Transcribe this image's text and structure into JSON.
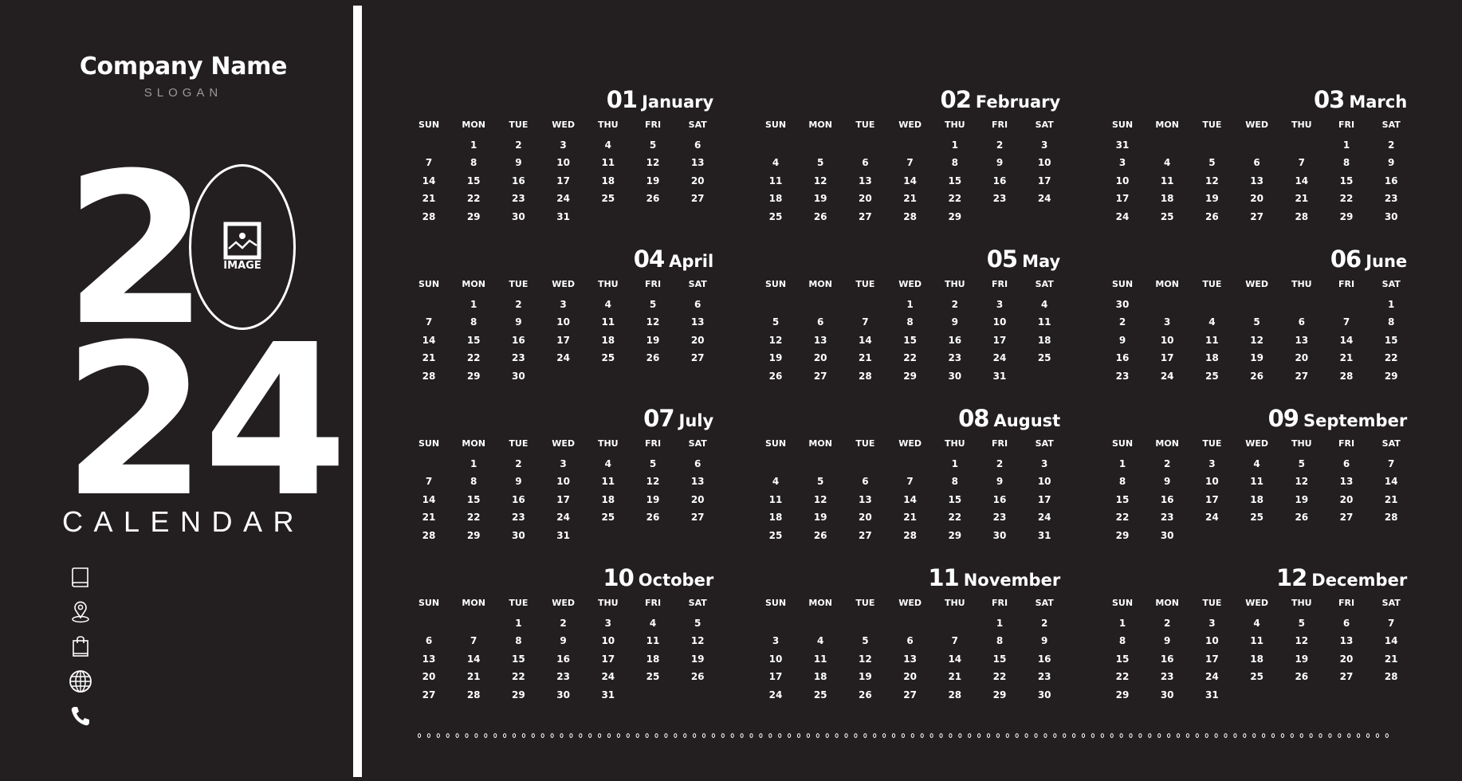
{
  "header": {
    "company_name": "Company Name",
    "slogan": "SLOGAN"
  },
  "hero": {
    "year_first": "2",
    "year_last": "24",
    "image_placeholder_label": "IMAGE",
    "subtitle": "CALENDAR"
  },
  "contact_icons": [
    "book-icon",
    "location-pin-icon",
    "shopping-bag-icon",
    "globe-icon",
    "phone-icon"
  ],
  "colors": {
    "background": "#231f20",
    "foreground": "#ffffff",
    "slogan": "#9a9899"
  },
  "weekdays": [
    "SUN",
    "MON",
    "TUE",
    "WED",
    "THU",
    "FRI",
    "SAT"
  ],
  "months": [
    {
      "num": "01",
      "name": "January",
      "weeks": [
        [
          "",
          "1",
          "2",
          "3",
          "4",
          "5",
          "6"
        ],
        [
          "7",
          "8",
          "9",
          "10",
          "11",
          "12",
          "13"
        ],
        [
          "14",
          "15",
          "16",
          "17",
          "18",
          "19",
          "20"
        ],
        [
          "21",
          "22",
          "23",
          "24",
          "25",
          "26",
          "27"
        ],
        [
          "28",
          "29",
          "30",
          "31",
          "",
          "",
          ""
        ]
      ]
    },
    {
      "num": "02",
      "name": "February",
      "weeks": [
        [
          "",
          "",
          "",
          "",
          "1",
          "2",
          "3"
        ],
        [
          "4",
          "5",
          "6",
          "7",
          "8",
          "9",
          "10"
        ],
        [
          "11",
          "12",
          "13",
          "14",
          "15",
          "16",
          "17"
        ],
        [
          "18",
          "19",
          "20",
          "21",
          "22",
          "23",
          "24"
        ],
        [
          "25",
          "26",
          "27",
          "28",
          "29",
          "",
          ""
        ]
      ]
    },
    {
      "num": "03",
      "name": "March",
      "weeks": [
        [
          "31",
          "",
          "",
          "",
          "",
          "1",
          "2"
        ],
        [
          "3",
          "4",
          "5",
          "6",
          "7",
          "8",
          "9"
        ],
        [
          "10",
          "11",
          "12",
          "13",
          "14",
          "15",
          "16"
        ],
        [
          "17",
          "18",
          "19",
          "20",
          "21",
          "22",
          "23"
        ],
        [
          "24",
          "25",
          "26",
          "27",
          "28",
          "29",
          "30"
        ]
      ]
    },
    {
      "num": "04",
      "name": "April",
      "weeks": [
        [
          "",
          "1",
          "2",
          "3",
          "4",
          "5",
          "6"
        ],
        [
          "7",
          "8",
          "9",
          "10",
          "11",
          "12",
          "13"
        ],
        [
          "14",
          "15",
          "16",
          "17",
          "18",
          "19",
          "20"
        ],
        [
          "21",
          "22",
          "23",
          "24",
          "25",
          "26",
          "27"
        ],
        [
          "28",
          "29",
          "30",
          "",
          "",
          "",
          ""
        ]
      ]
    },
    {
      "num": "05",
      "name": "May",
      "weeks": [
        [
          "",
          "",
          "",
          "1",
          "2",
          "3",
          "4"
        ],
        [
          "5",
          "6",
          "7",
          "8",
          "9",
          "10",
          "11"
        ],
        [
          "12",
          "13",
          "14",
          "15",
          "16",
          "17",
          "18"
        ],
        [
          "19",
          "20",
          "21",
          "22",
          "23",
          "24",
          "25"
        ],
        [
          "26",
          "27",
          "28",
          "29",
          "30",
          "31",
          ""
        ]
      ]
    },
    {
      "num": "06",
      "name": "June",
      "weeks": [
        [
          "30",
          "",
          "",
          "",
          "",
          "",
          "1"
        ],
        [
          "2",
          "3",
          "4",
          "5",
          "6",
          "7",
          "8"
        ],
        [
          "9",
          "10",
          "11",
          "12",
          "13",
          "14",
          "15"
        ],
        [
          "16",
          "17",
          "18",
          "19",
          "20",
          "21",
          "22"
        ],
        [
          "23",
          "24",
          "25",
          "26",
          "27",
          "28",
          "29"
        ]
      ]
    },
    {
      "num": "07",
      "name": "July",
      "weeks": [
        [
          "",
          "1",
          "2",
          "3",
          "4",
          "5",
          "6"
        ],
        [
          "7",
          "8",
          "9",
          "10",
          "11",
          "12",
          "13"
        ],
        [
          "14",
          "15",
          "16",
          "17",
          "18",
          "19",
          "20"
        ],
        [
          "21",
          "22",
          "23",
          "24",
          "25",
          "26",
          "27"
        ],
        [
          "28",
          "29",
          "30",
          "31",
          "",
          "",
          ""
        ]
      ]
    },
    {
      "num": "08",
      "name": "August",
      "weeks": [
        [
          "",
          "",
          "",
          "",
          "1",
          "2",
          "3"
        ],
        [
          "4",
          "5",
          "6",
          "7",
          "8",
          "9",
          "10"
        ],
        [
          "11",
          "12",
          "13",
          "14",
          "15",
          "16",
          "17"
        ],
        [
          "18",
          "19",
          "20",
          "21",
          "22",
          "23",
          "24"
        ],
        [
          "25",
          "26",
          "27",
          "28",
          "29",
          "30",
          "31"
        ]
      ]
    },
    {
      "num": "09",
      "name": "September",
      "weeks": [
        [
          "1",
          "2",
          "3",
          "4",
          "5",
          "6",
          "7"
        ],
        [
          "8",
          "9",
          "10",
          "11",
          "12",
          "13",
          "14"
        ],
        [
          "15",
          "16",
          "17",
          "18",
          "19",
          "20",
          "21"
        ],
        [
          "22",
          "23",
          "24",
          "25",
          "26",
          "27",
          "28"
        ],
        [
          "29",
          "30",
          "",
          "",
          "",
          "",
          ""
        ]
      ]
    },
    {
      "num": "10",
      "name": "October",
      "weeks": [
        [
          "",
          "",
          "1",
          "2",
          "3",
          "4",
          "5"
        ],
        [
          "6",
          "7",
          "8",
          "9",
          "10",
          "11",
          "12"
        ],
        [
          "13",
          "14",
          "15",
          "16",
          "17",
          "18",
          "19"
        ],
        [
          "20",
          "21",
          "22",
          "23",
          "24",
          "25",
          "26"
        ],
        [
          "27",
          "28",
          "29",
          "30",
          "31",
          "",
          ""
        ]
      ]
    },
    {
      "num": "11",
      "name": "November",
      "weeks": [
        [
          "",
          "",
          "",
          "",
          "",
          "1",
          "2"
        ],
        [
          "3",
          "4",
          "5",
          "6",
          "7",
          "8",
          "9"
        ],
        [
          "10",
          "11",
          "12",
          "13",
          "14",
          "15",
          "16"
        ],
        [
          "17",
          "18",
          "19",
          "20",
          "21",
          "22",
          "23"
        ],
        [
          "24",
          "25",
          "26",
          "27",
          "28",
          "29",
          "30"
        ]
      ]
    },
    {
      "num": "12",
      "name": "December",
      "weeks": [
        [
          "1",
          "2",
          "3",
          "4",
          "5",
          "6",
          "7"
        ],
        [
          "8",
          "9",
          "10",
          "11",
          "12",
          "13",
          "14"
        ],
        [
          "15",
          "16",
          "17",
          "18",
          "19",
          "20",
          "21"
        ],
        [
          "22",
          "23",
          "24",
          "25",
          "26",
          "27",
          "28"
        ],
        [
          "29",
          "30",
          "31",
          "",
          "",
          "",
          ""
        ]
      ]
    }
  ]
}
